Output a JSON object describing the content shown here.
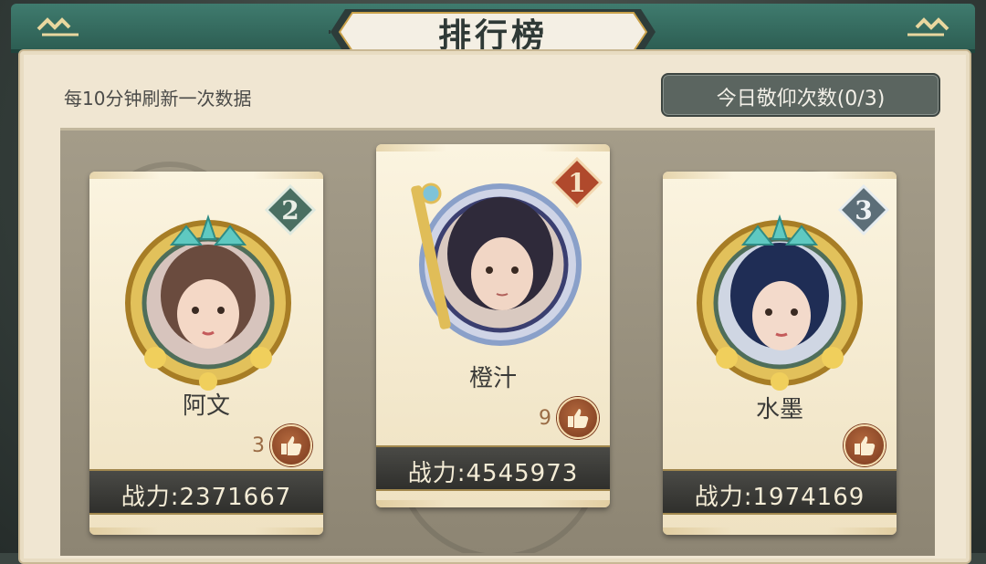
{
  "header": {
    "title": "排行榜"
  },
  "info": {
    "refresh_note": "每10分钟刷新一次数据",
    "worship_label": "今日敬仰次数(0/3)"
  },
  "colors": {
    "banner": "#2d5e53",
    "parchment": "#f0e6d2",
    "power_bar": "#2f2f2c",
    "like_button": "#8a4527",
    "gold": "#c9a14a"
  },
  "leaderboard": [
    {
      "rank": "1",
      "name": "橙汁",
      "likes": "9",
      "power": "战力:4545973",
      "avatar_icon": "purple-robed-swordsman-avatar"
    },
    {
      "rank": "2",
      "name": "阿文",
      "likes": "3",
      "power": "战力:2371667",
      "avatar_icon": "brown-haired-girl-avatar"
    },
    {
      "rank": "3",
      "name": "水墨",
      "likes": "",
      "power": "战力:1974169",
      "avatar_icon": "blue-haired-woman-avatar"
    }
  ],
  "icons": {
    "like": "thumbs-up-icon",
    "rank_badge": "diamond-rank-badge"
  }
}
